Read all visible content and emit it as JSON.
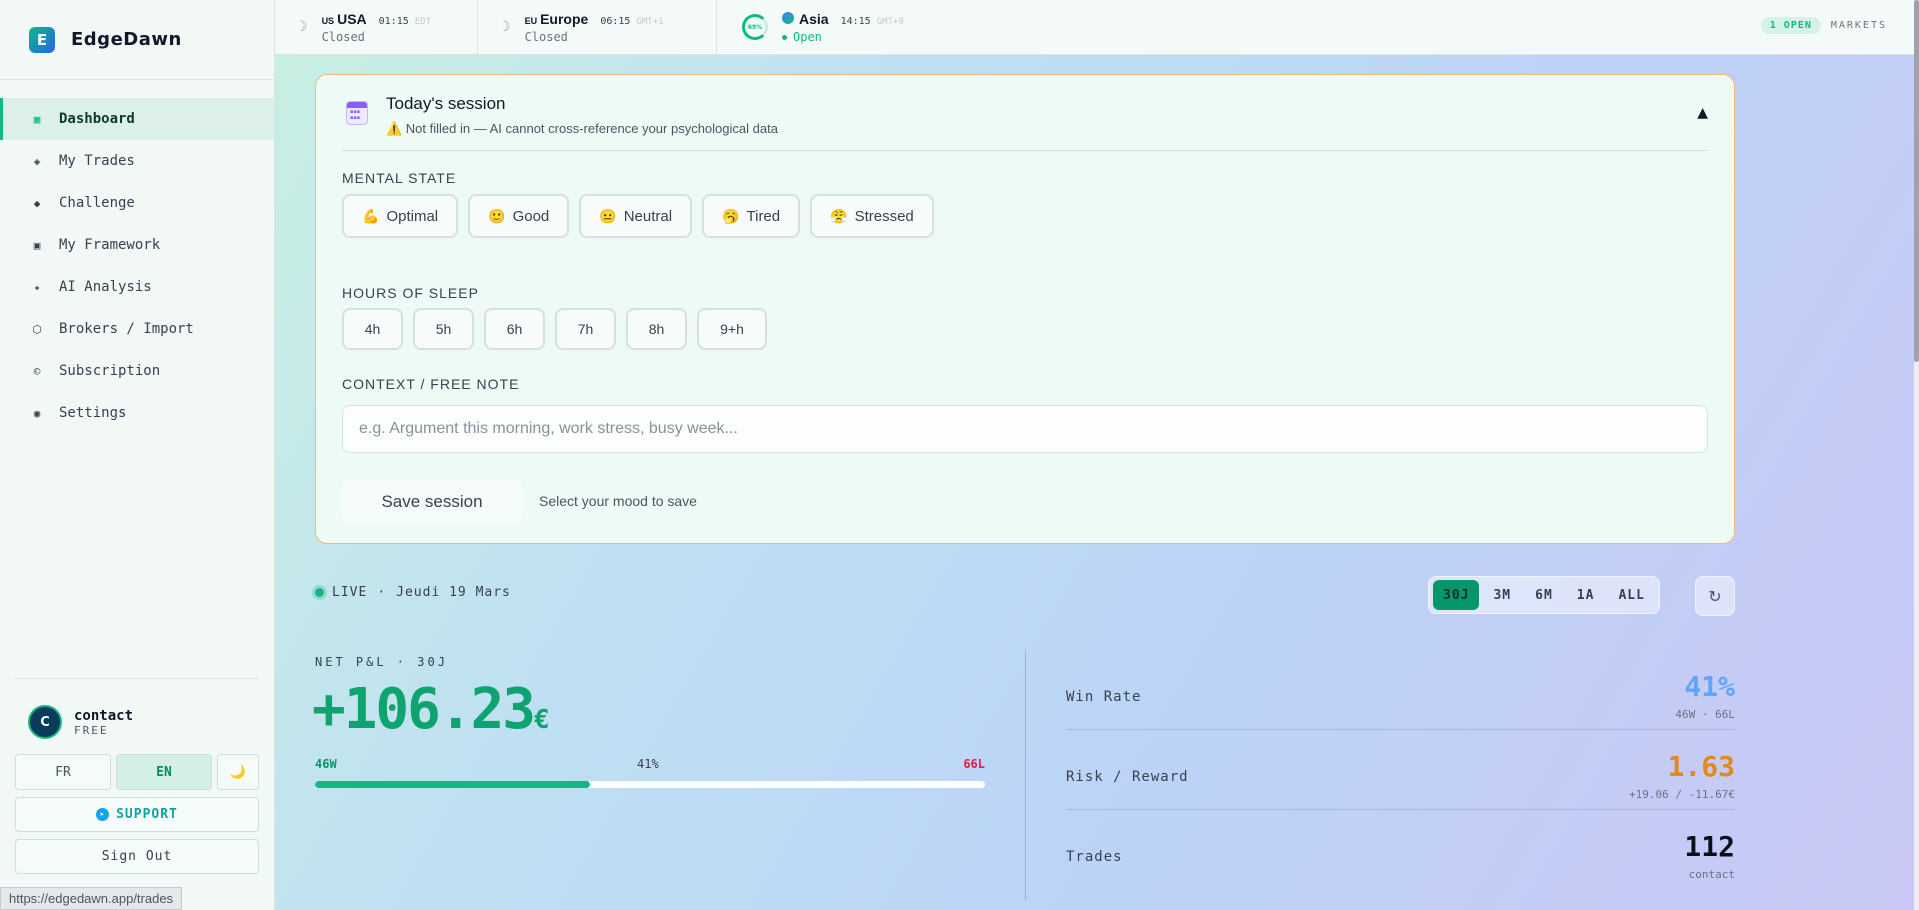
{
  "app": {
    "name": "EdgeDawn",
    "logo_letter": "E"
  },
  "sidebar": {
    "items": [
      {
        "label": "Dashboard",
        "icon": "grid-icon",
        "glyph": "▦"
      },
      {
        "label": "My Trades",
        "icon": "diamond-outline-icon",
        "glyph": "◈"
      },
      {
        "label": "Challenge",
        "icon": "diamond-icon",
        "glyph": "◆"
      },
      {
        "label": "My Framework",
        "icon": "square-icon",
        "glyph": "▣"
      },
      {
        "label": "AI Analysis",
        "icon": "sparkle-icon",
        "glyph": "✦"
      },
      {
        "label": "Brokers / Import",
        "icon": "hexagon-icon",
        "glyph": "⬡"
      },
      {
        "label": "Subscription",
        "icon": "copyright-icon",
        "glyph": "©"
      },
      {
        "label": "Settings",
        "icon": "target-icon",
        "glyph": "◉"
      }
    ],
    "user": {
      "initial": "C",
      "name": "contact",
      "plan": "FREE"
    },
    "lang": {
      "fr": "FR",
      "en": "EN",
      "theme_glyph": "🌙"
    },
    "support_label": "SUPPORT",
    "signout_label": "Sign Out"
  },
  "status_url": "https://edgedawn.app/trades",
  "markets": [
    {
      "flag": "US",
      "name": "USA",
      "time": "01:15",
      "tz": "EDT",
      "status": "Closed"
    },
    {
      "flag": "EU",
      "name": "Europe",
      "time": "06:15",
      "tz": "GMT+1",
      "status": "Closed"
    },
    {
      "name": "Asia",
      "time": "14:15",
      "tz": "GMT+9",
      "status": "Open",
      "progress": "69%"
    }
  ],
  "topbar": {
    "open_count": "1 OPEN",
    "markets_label": "MARKETS"
  },
  "session": {
    "title": "Today's session",
    "warning": "⚠️ Not filled in — AI cannot cross-reference your psychological data",
    "collapse_glyph": "▲",
    "mental_label": "MENTAL STATE",
    "moods": [
      {
        "emoji": "💪",
        "label": "Optimal"
      },
      {
        "emoji": "🙂",
        "label": "Good"
      },
      {
        "emoji": "😐",
        "label": "Neutral"
      },
      {
        "emoji": "🥱",
        "label": "Tired"
      },
      {
        "emoji": "😤",
        "label": "Stressed"
      }
    ],
    "sleep_label": "HOURS OF SLEEP",
    "sleep": [
      "4h",
      "5h",
      "6h",
      "7h",
      "8h",
      "9+h"
    ],
    "note_label": "CONTEXT / FREE NOTE",
    "note_placeholder": "e.g. Argument this morning, work stress, busy week...",
    "save_label": "Save session",
    "save_hint": "Select your mood to save"
  },
  "live": {
    "label": "LIVE",
    "date": "Jeudi 19 Mars"
  },
  "periods": [
    "30J",
    "3M",
    "6M",
    "1A",
    "ALL"
  ],
  "active_period": "30J",
  "refresh_glyph": "↻",
  "pnl": {
    "label": "NET P&L · 30J",
    "value": "+106.23",
    "currency": "€",
    "wins": "46W",
    "win_pct": "41%",
    "losses": "66L",
    "win_fraction": 0.41
  },
  "stats": [
    {
      "name": "Win Rate",
      "value": "41%",
      "sub": "46W · 66L",
      "color": "#60a5fa"
    },
    {
      "name": "Risk / Reward",
      "value": "1.63",
      "sub": "+19.06 / -11.67€",
      "color": "#e08a1c"
    },
    {
      "name": "Trades",
      "value": "112",
      "sub": "contact",
      "color": "#0b0f1a"
    }
  ]
}
